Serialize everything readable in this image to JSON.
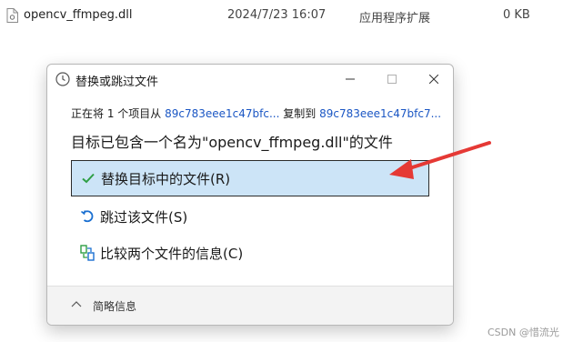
{
  "file_row": {
    "name": "opencv_ffmpeg.dll",
    "date": "2024/7/23 16:07",
    "type": "应用程序扩展",
    "size": "0 KB"
  },
  "dialog": {
    "title": "替换或跳过文件",
    "copy_prefix": "正在将 1 个项目从",
    "source": "89c783eee1c47bfc...",
    "copy_middle": "复制到",
    "destination": "89c783eee1c47bfc7...",
    "heading": "目标已包含一个名为\"opencv_ffmpeg.dll\"的文件",
    "options": [
      {
        "label": "替换目标中的文件(R)",
        "icon": "checkmark-icon"
      },
      {
        "label": "跳过该文件(S)",
        "icon": "skip-icon"
      },
      {
        "label": "比较两个文件的信息(C)",
        "icon": "compare-icon"
      }
    ],
    "footer_label": "简略信息"
  },
  "colors": {
    "selected_bg": "#cce4f7",
    "link": "#1a56c4",
    "arrow": "#e53935",
    "check": "#2e9e44"
  },
  "watermark": "CSDN @惜流光"
}
